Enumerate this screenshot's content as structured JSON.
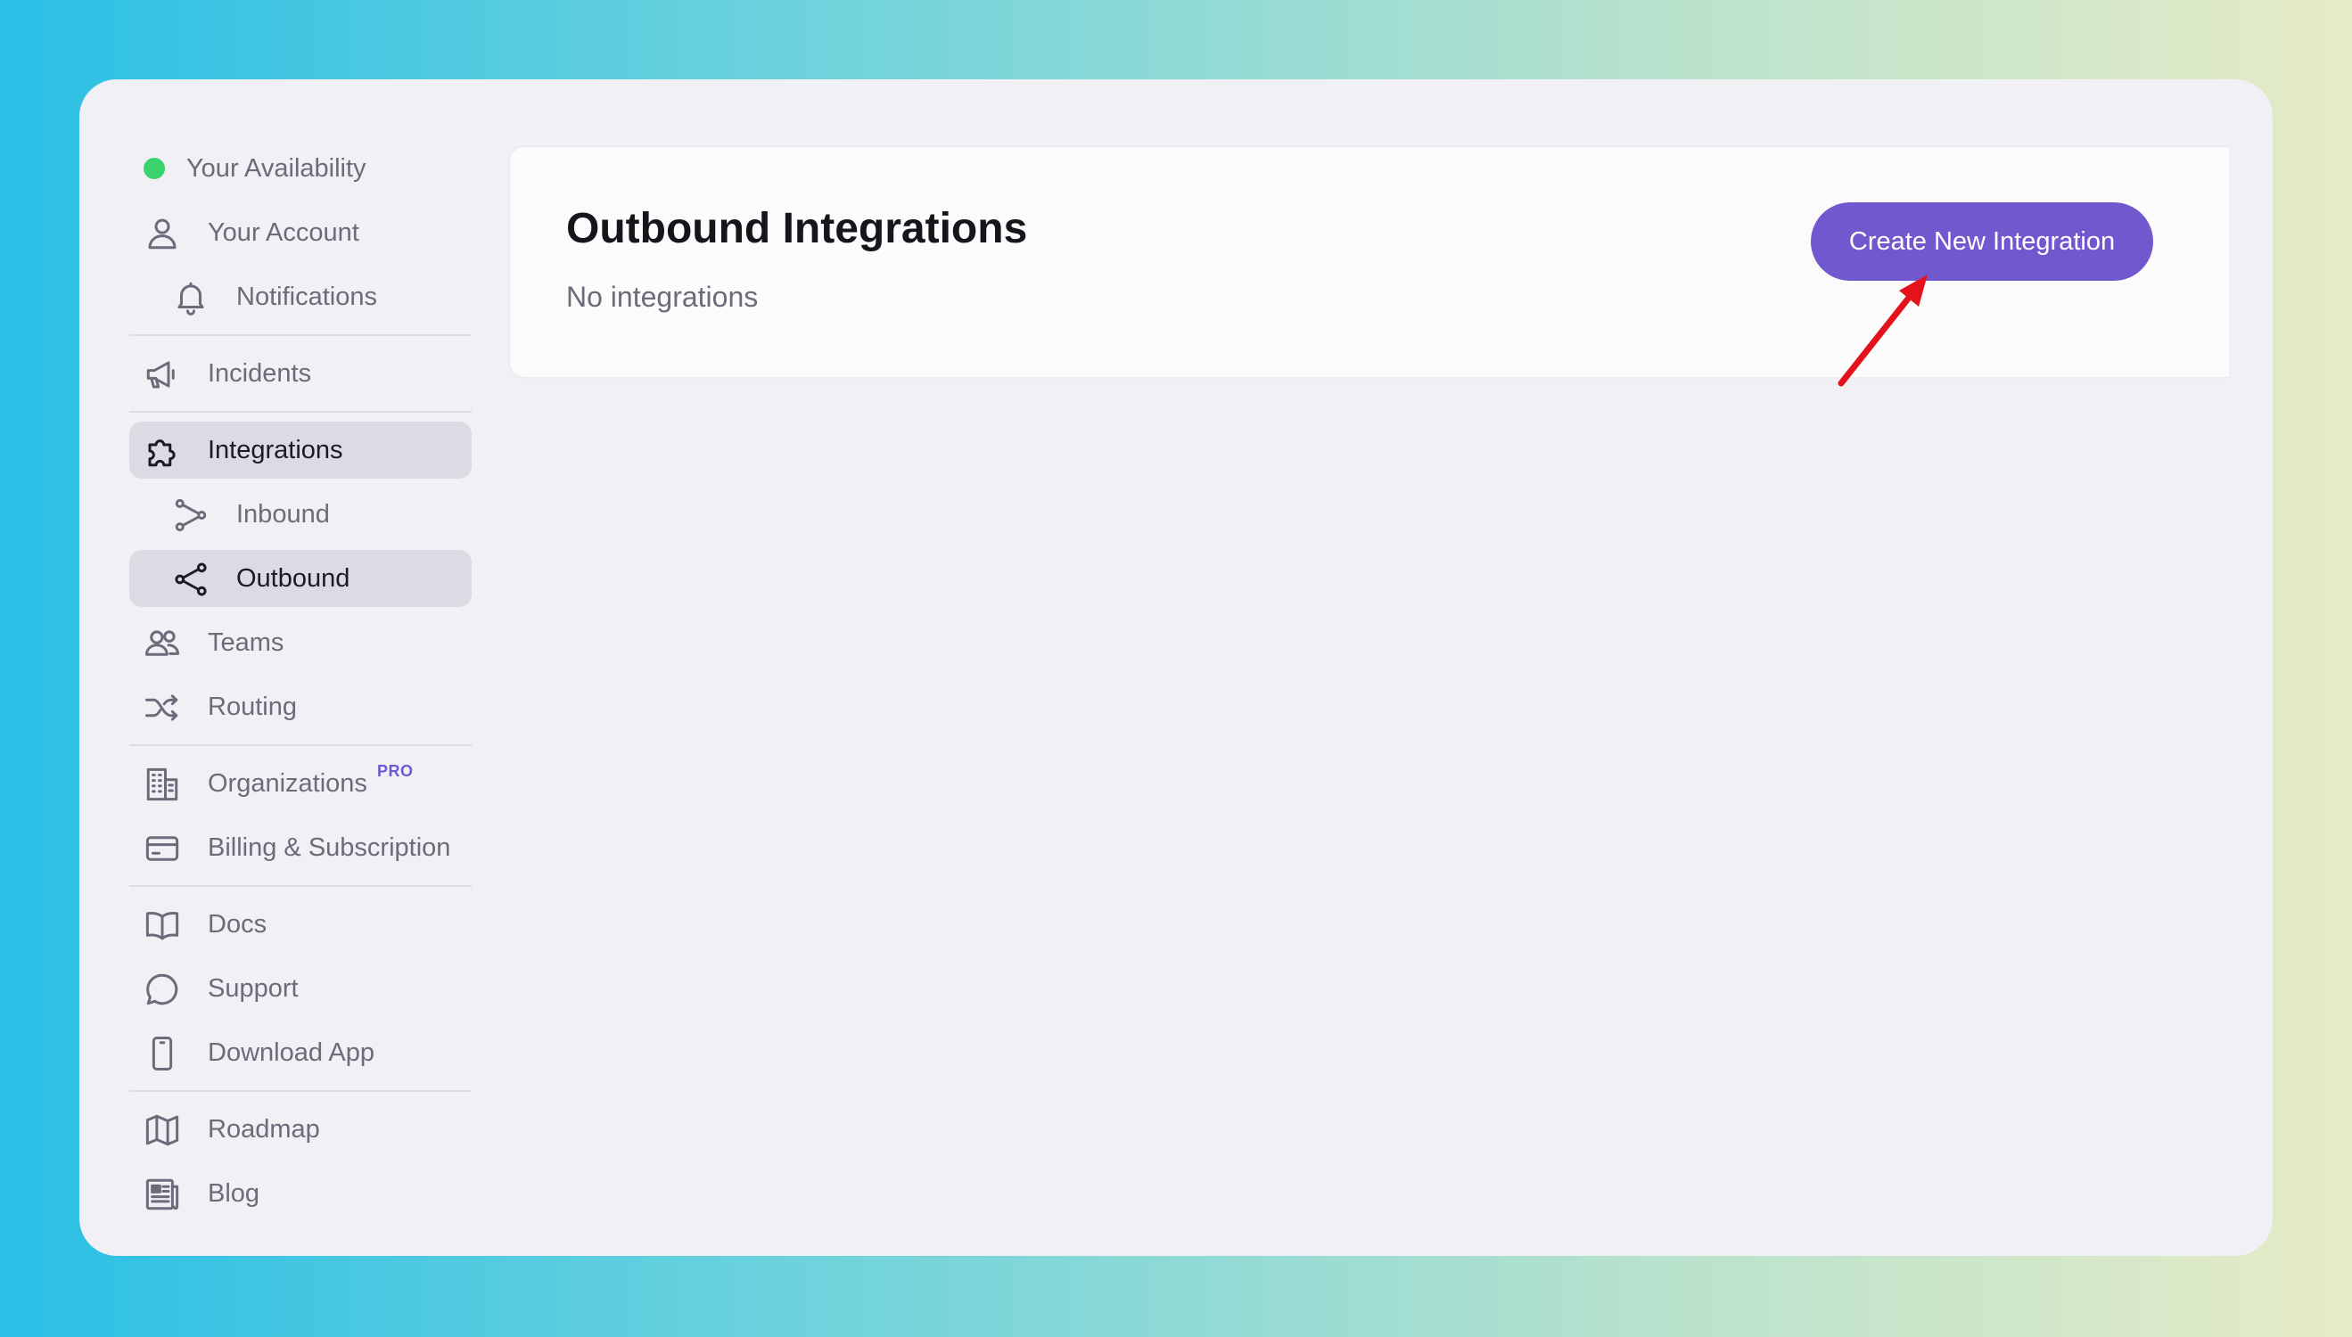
{
  "sidebar": {
    "availability": {
      "label": "Your Availability",
      "status_color": "#3ad36b"
    },
    "items": [
      {
        "label": "Your Account",
        "icon": "user-icon"
      },
      {
        "label": "Notifications",
        "icon": "bell-icon"
      },
      {
        "label": "Incidents",
        "icon": "megaphone-icon"
      },
      {
        "label": "Integrations",
        "icon": "puzzle-icon"
      },
      {
        "label": "Inbound",
        "icon": "inbound-icon"
      },
      {
        "label": "Outbound",
        "icon": "share-icon"
      },
      {
        "label": "Teams",
        "icon": "users-icon"
      },
      {
        "label": "Routing",
        "icon": "shuffle-icon"
      },
      {
        "label": "Organizations",
        "icon": "building-icon",
        "badge": "PRO"
      },
      {
        "label": "Billing & Subscription",
        "icon": "credit-card-icon"
      },
      {
        "label": "Docs",
        "icon": "book-icon"
      },
      {
        "label": "Support",
        "icon": "chat-icon"
      },
      {
        "label": "Download App",
        "icon": "phone-icon"
      },
      {
        "label": "Roadmap",
        "icon": "map-icon"
      },
      {
        "label": "Blog",
        "icon": "newspaper-icon"
      }
    ]
  },
  "main": {
    "title": "Outbound Integrations",
    "empty_text": "No integrations",
    "create_button": "Create New Integration",
    "accent_color": "#7158cf",
    "annotation_color": "#e3121b"
  }
}
